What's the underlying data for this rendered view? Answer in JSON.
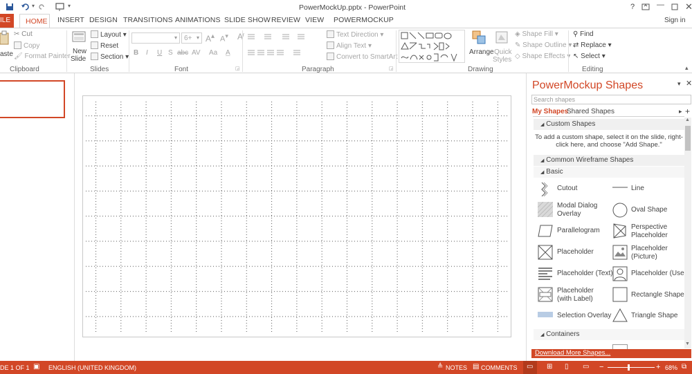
{
  "window": {
    "title": "PowerMockUp.pptx - PowerPoint",
    "help": "?",
    "sign_in": "Sign in"
  },
  "tabs": [
    "ILE",
    "HOME",
    "INSERT",
    "DESIGN",
    "TRANSITIONS",
    "ANIMATIONS",
    "SLIDE SHOW",
    "REVIEW",
    "VIEW",
    "POWERMOCKUP"
  ],
  "ribbon": {
    "clipboard": {
      "label": "Clipboard",
      "paste": "aste",
      "cut": "Cut",
      "copy": "Copy",
      "format_painter": "Format Painter"
    },
    "slides": {
      "label": "Slides",
      "new_slide": "New",
      "new_slide2": "Slide",
      "layout": "Layout",
      "reset": "Reset",
      "section": "Section"
    },
    "font": {
      "label": "Font",
      "font_name": "",
      "font_size": "6+",
      "buttons": [
        "B",
        "I",
        "U",
        "S",
        "abc",
        "AV",
        "Aa",
        "A"
      ]
    },
    "paragraph": {
      "label": "Paragraph",
      "text_direction": "Text Direction",
      "align_text": "Align Text",
      "smartart": "Convert to SmartArt"
    },
    "drawing": {
      "label": "Drawing",
      "arrange": "Arrange",
      "quick_styles": "Quick",
      "quick_styles2": "Styles",
      "shape_fill": "Shape Fill",
      "shape_outline": "Shape Outline",
      "shape_effects": "Shape Effects"
    },
    "editing": {
      "label": "Editing",
      "find": "Find",
      "replace": "Replace",
      "select": "Select"
    }
  },
  "pane": {
    "title": "PowerMockup Shapes",
    "search_placeholder": "Search shapes",
    "tab_my": "My Shapes",
    "tab_shared": "Shared Shapes",
    "custom_header": "Custom Shapes",
    "custom_hint": "To add a custom shape, select it on the slide, right-click here, and choose \"Add Shape.\"",
    "wireframe_header": "Common Wireframe Shapes",
    "basic_header": "Basic",
    "shapes_left": [
      "Cutout",
      "Modal Dialog Overlay",
      "Parallelogram",
      "Placeholder",
      "Placeholder (Text)",
      "Placeholder (with Label)",
      "Selection Overlay"
    ],
    "shapes_right": [
      "Line",
      "Oval Shape",
      "Perspective Placeholder",
      "Placeholder (Picture)",
      "Placeholder (User)",
      "Rectangle Shape",
      "Triangle Shape"
    ],
    "containers_header": "Containers",
    "download_link": "Download More Shapes..."
  },
  "status": {
    "slide": "DE 1 OF 1",
    "language": "ENGLISH (UNITED KINGDOM)",
    "notes": "NOTES",
    "comments": "COMMENTS",
    "zoom": "68%"
  },
  "colors": {
    "accent": "#d24726",
    "pane_title": "#d24726"
  }
}
